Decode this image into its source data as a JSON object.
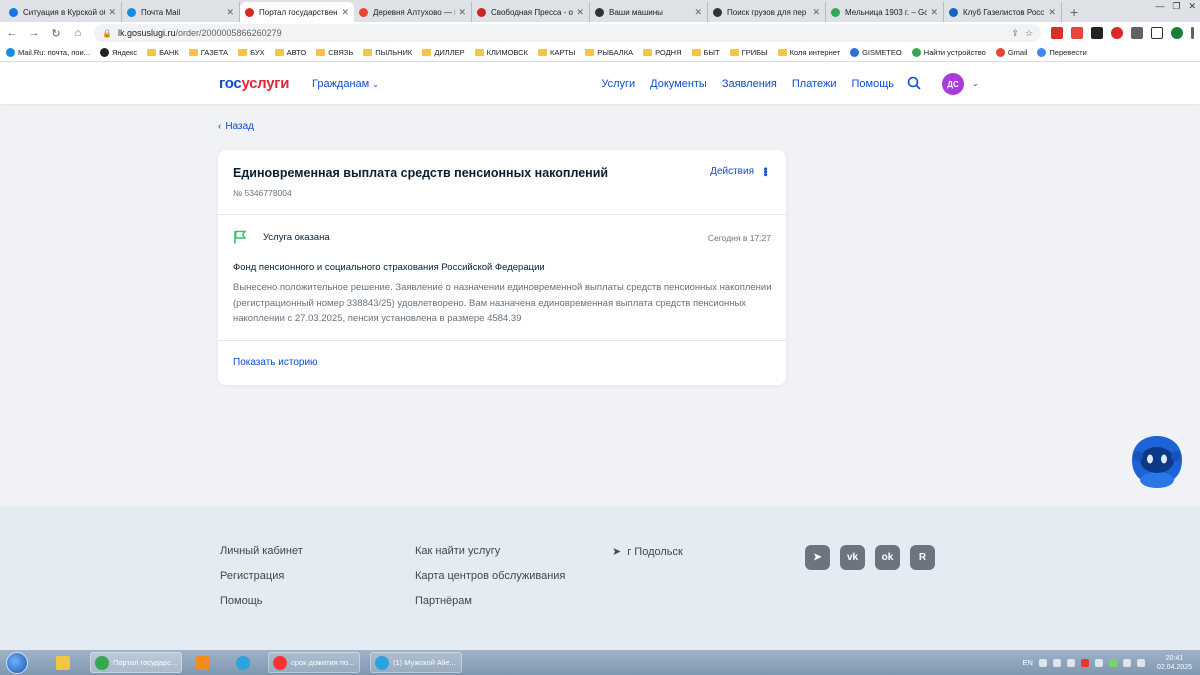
{
  "browser": {
    "tabs": [
      {
        "title": "Ситуация в Курской об",
        "color": "#1a73e8",
        "active": false
      },
      {
        "title": "Почта Mail",
        "color": "#168de2",
        "active": false
      },
      {
        "title": "Портал государственн",
        "color": "#d52b1e",
        "active": true
      },
      {
        "title": "Деревня Алтухово — К",
        "color": "#ea4335",
        "active": false
      },
      {
        "title": "Свободная Пресса - о",
        "color": "#c62828",
        "active": false
      },
      {
        "title": "Ваши машины",
        "color": "#333333",
        "active": false
      },
      {
        "title": "Поиск грузов для пер",
        "color": "#333333",
        "active": false
      },
      {
        "title": "Мельница 1903 г. – Go",
        "color": "#34a853",
        "active": false
      },
      {
        "title": "Клуб Газелистов Росс",
        "color": "#1565c0",
        "active": false
      }
    ],
    "new_tab": "+",
    "url_host": "lk.gosuslugi.ru",
    "url_path": "/order/2000005866260279",
    "bookmarks": [
      {
        "label": "Mail.Ru: почта, пои...",
        "kind": "site",
        "color": "#168de2"
      },
      {
        "label": "Яндекс",
        "kind": "site",
        "color": "#222222"
      },
      {
        "label": "БАНК",
        "kind": "folder"
      },
      {
        "label": "ГАЗЕТА",
        "kind": "folder"
      },
      {
        "label": "БУХ",
        "kind": "folder"
      },
      {
        "label": "АВТО",
        "kind": "folder"
      },
      {
        "label": "СВЯЗЬ",
        "kind": "folder"
      },
      {
        "label": "ПЫЛЬНИК",
        "kind": "folder"
      },
      {
        "label": "ДИЛЛЕР",
        "kind": "folder"
      },
      {
        "label": "КЛИМОВСК",
        "kind": "folder"
      },
      {
        "label": "КАРТЫ",
        "kind": "folder"
      },
      {
        "label": "РЫБАЛКА",
        "kind": "folder"
      },
      {
        "label": "РОДНЯ",
        "kind": "folder"
      },
      {
        "label": "БЫТ",
        "kind": "folder"
      },
      {
        "label": "ГРИБЫ",
        "kind": "folder"
      },
      {
        "label": "Коля интернет",
        "kind": "folder"
      },
      {
        "label": "GISMETEO",
        "kind": "site",
        "color": "#2f6fd6"
      },
      {
        "label": "Найти устройство",
        "kind": "site",
        "color": "#34a853"
      },
      {
        "label": "Gmail",
        "kind": "site",
        "color": "#ea4335"
      },
      {
        "label": "Перевести",
        "kind": "site",
        "color": "#4285f4"
      }
    ]
  },
  "header": {
    "logo_part1": "гос",
    "logo_part2": "услуги",
    "citizens": "Гражданам",
    "nav": [
      "Услуги",
      "Документы",
      "Заявления",
      "Платежи",
      "Помощь"
    ],
    "avatar_initials": "ДС"
  },
  "main": {
    "back_label": "Назад",
    "card": {
      "title": "Единовременная выплата средств пенсионных накоплений",
      "number": "№ 5346778004",
      "actions_label": "Действия",
      "status_text": "Услуга оказана",
      "status_time": "Сегодня в 17:27",
      "status_color": "#2ec06d",
      "organization": "Фонд пенсионного и социального страхования Российской Федерации",
      "decision": "Вынесено положительное решение. Заявление о назначении единовременной выплаты средств пенсионных накоплении (регистрационный номер 338843/25) удовлетворено. Вам назначена единовременная выплата средств пенсионных накоплении с 27.03.2025, пенсия установлена в размере 4584.39",
      "history_link": "Показать историю"
    }
  },
  "footer": {
    "col1": [
      "Личный кабинет",
      "Регистрация",
      "Помощь"
    ],
    "col2": [
      "Как найти услугу",
      "Карта центров обслуживания",
      "Партнёрам"
    ],
    "city": "г Подольск",
    "socials": [
      "telegram-icon",
      "vk-icon",
      "ok-icon",
      "rutube-icon"
    ]
  },
  "taskbar": {
    "windows": [
      {
        "label": "Портал государс...",
        "color": "#34a853",
        "active": true
      },
      {
        "label": "срок дожития по...",
        "color": "#ff3333",
        "active": false
      },
      {
        "label": "(1) Мужской Alie...",
        "color": "#2aa3df",
        "active": false
      }
    ],
    "lang": "EN",
    "time": "20:41",
    "date": "02.04.2025"
  }
}
